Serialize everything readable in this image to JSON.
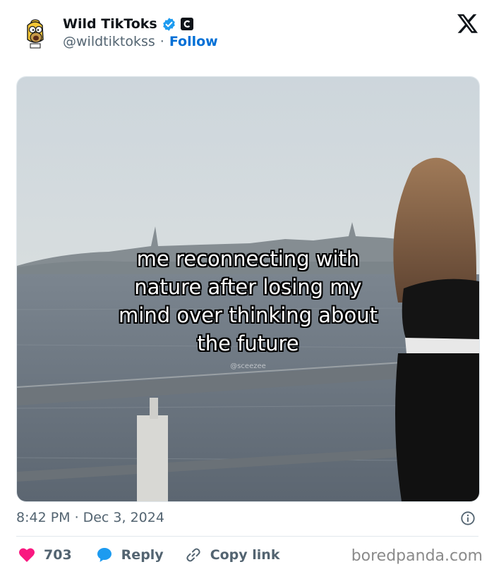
{
  "author": {
    "display_name": "Wild TikToks",
    "handle": "@wildtiktokss",
    "separator": "·",
    "follow_label": "Follow",
    "verified": true,
    "affiliate_badge_letter": "C",
    "avatar_icon": "cartoon-character-avatar"
  },
  "media": {
    "caption_lines": [
      "me reconnecting with",
      "nature after losing my",
      "mind over thinking about",
      "the future"
    ],
    "watermark": "@sceezee"
  },
  "meta": {
    "time": "8:42 PM",
    "separator": "·",
    "date": "Dec 3, 2024"
  },
  "actions": {
    "like_count": "703",
    "reply_label": "Reply",
    "copy_link_label": "Copy link"
  },
  "brand": "boredpanda.com",
  "colors": {
    "accent": "#006fd6",
    "like": "#f91880",
    "reply": "#1d9bf0",
    "muted": "#536471"
  }
}
